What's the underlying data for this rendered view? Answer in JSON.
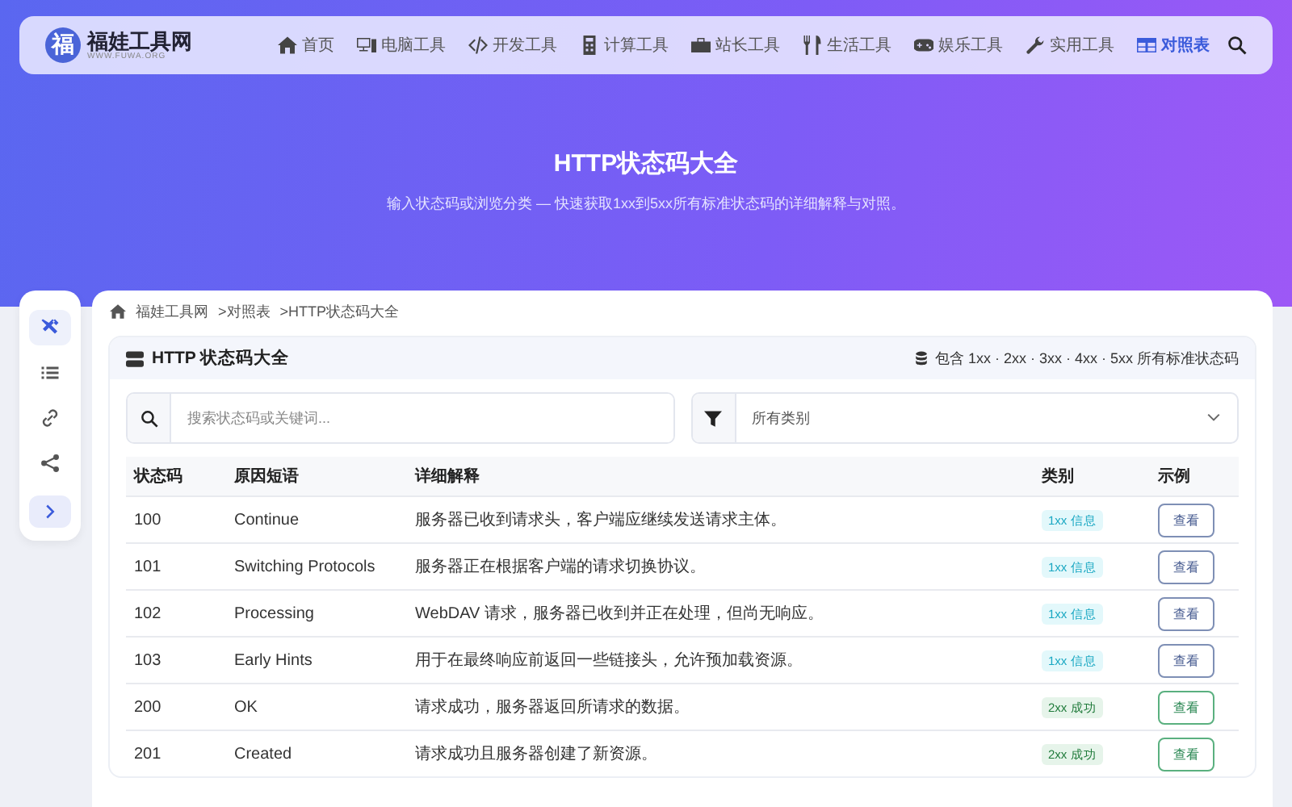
{
  "brand": {
    "name": "福娃工具网",
    "domain": "WWW.FUWA.ORG",
    "logo_char": "福"
  },
  "nav": [
    {
      "label": "首页",
      "selected": false
    },
    {
      "label": "电脑工具",
      "selected": false
    },
    {
      "label": "开发工具",
      "selected": false
    },
    {
      "label": "计算工具",
      "selected": false
    },
    {
      "label": "站长工具",
      "selected": false
    },
    {
      "label": "生活工具",
      "selected": false
    },
    {
      "label": "娱乐工具",
      "selected": false
    },
    {
      "label": "实用工具",
      "selected": false
    },
    {
      "label": "对照表",
      "selected": true
    }
  ],
  "hero": {
    "title": "HTTP状态码大全",
    "subtitle": "输入状态码或浏览分类 — 快速获取1xx到5xx所有标准状态码的详细解释与对照。"
  },
  "sidebar": {
    "items": [
      {
        "selected": true
      },
      {
        "selected": false
      },
      {
        "selected": false
      },
      {
        "selected": false
      }
    ]
  },
  "breadcrumb": [
    "福娃工具网",
    ">对照表",
    ">HTTP状态码大全"
  ],
  "panel": {
    "title": "HTTP 状态码大全",
    "note": "包含 1xx · 2xx · 3xx · 4xx · 5xx 所有标准状态码"
  },
  "search": {
    "placeholder": "搜索状态码或关键词..."
  },
  "filter": {
    "value": "所有类别"
  },
  "table": {
    "columns": [
      "状态码",
      "原因短语",
      "详细解释",
      "类别",
      "示例"
    ],
    "rows": [
      {
        "code": "100",
        "phrase": "Continue",
        "detail": "服务器已收到请求头，客户端应继续发送请求主体。",
        "category": "1xx 信息",
        "kind": "info",
        "action": "查看"
      },
      {
        "code": "101",
        "phrase": "Switching Protocols",
        "detail": "服务器正在根据客户端的请求切换协议。",
        "category": "1xx 信息",
        "kind": "info",
        "action": "查看"
      },
      {
        "code": "102",
        "phrase": "Processing",
        "detail": "WebDAV 请求，服务器已收到并正在处理，但尚无响应。",
        "category": "1xx 信息",
        "kind": "info",
        "action": "查看"
      },
      {
        "code": "103",
        "phrase": "Early Hints",
        "detail": "用于在最终响应前返回一些链接头，允许预加载资源。",
        "category": "1xx 信息",
        "kind": "info",
        "action": "查看"
      },
      {
        "code": "200",
        "phrase": "OK",
        "detail": "请求成功，服务器返回所请求的数据。",
        "category": "2xx 成功",
        "kind": "success",
        "action": "查看"
      },
      {
        "code": "201",
        "phrase": "Created",
        "detail": "请求成功且服务器创建了新资源。",
        "category": "2xx 成功",
        "kind": "success",
        "action": "查看"
      }
    ]
  }
}
